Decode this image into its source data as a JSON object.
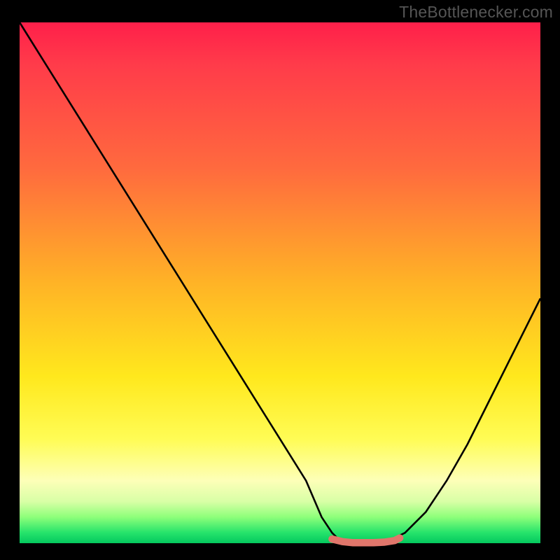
{
  "attribution": "TheBottleneсker.com",
  "chart_data": {
    "type": "line",
    "title": "",
    "xlabel": "",
    "ylabel": "",
    "xlim": [
      0,
      100
    ],
    "ylim": [
      0,
      100
    ],
    "series": [
      {
        "name": "bottleneck-curve",
        "x": [
          0,
          5,
          10,
          15,
          20,
          25,
          30,
          35,
          40,
          45,
          50,
          55,
          58,
          60,
          62,
          66,
          70,
          74,
          78,
          82,
          86,
          90,
          94,
          98,
          100
        ],
        "y": [
          100,
          92,
          84,
          76,
          68,
          60,
          52,
          44,
          36,
          28,
          20,
          12,
          5,
          2,
          0,
          0,
          0,
          2,
          6,
          12,
          19,
          27,
          35,
          43,
          47
        ]
      },
      {
        "name": "optimal-band",
        "x": [
          60,
          62,
          64,
          66,
          68,
          70,
          72,
          73
        ],
        "y": [
          0.8,
          0.3,
          0.1,
          0.1,
          0.1,
          0.2,
          0.5,
          1.0
        ]
      }
    ],
    "colors": {
      "curve": "#000000",
      "optimal": "#e0766b",
      "gradient_top": "#ff1f4a",
      "gradient_mid": "#ffe81d",
      "gradient_bottom": "#04c85e"
    }
  }
}
